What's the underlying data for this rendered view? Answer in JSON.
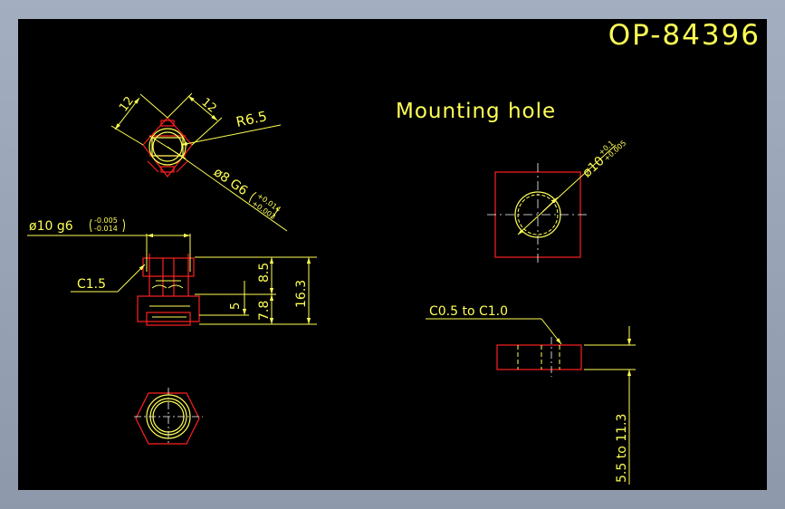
{
  "colors": {
    "window_bg": "#97a3b5",
    "canvas_bg": "#000000",
    "annotation": "#ffff55",
    "part_outline": "#ff2020",
    "centerline": "#ffffff"
  },
  "drawing": {
    "part_number": "OP-84396",
    "section_title": "Mounting hole",
    "top_view": {
      "dim_width_left": "12",
      "dim_width_right": "12",
      "radius": "R6.5",
      "bore_symbol": "ø8 G6",
      "bore_tol_upper": "+0.014",
      "bore_tol_lower": "+0.003"
    },
    "side_view": {
      "shaft_symbol": "ø10 g6",
      "shaft_tol_upper": "-0.005",
      "shaft_tol_lower": "-0.014",
      "chamfer": "C1.5",
      "dim_upper": "8.5",
      "dim_lower": "7.8",
      "dim_total": "16.3",
      "dim_inner": "5"
    },
    "mounting_hole": {
      "hole_symbol": "ø10",
      "hole_tol_upper": "+0.1",
      "hole_tol_lower": "+0.005",
      "chamfer_range": "C0.5 to C1.0",
      "thickness_range": "5.5 to 11.3"
    }
  }
}
